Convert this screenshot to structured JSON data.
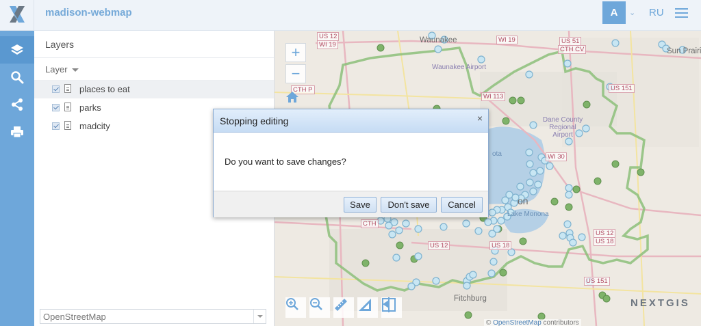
{
  "app": {
    "title": "madison-webmap",
    "logo": "nextgis-x-logo"
  },
  "header": {
    "avatar_letter": "A",
    "language": "RU",
    "menu_icon": "hamburger-menu-icon"
  },
  "sidebar": {
    "items": [
      {
        "icon": "layers-icon",
        "active": true
      },
      {
        "icon": "search-icon",
        "active": false
      },
      {
        "icon": "share-icon",
        "active": false
      },
      {
        "icon": "print-icon",
        "active": false
      }
    ]
  },
  "layers_panel": {
    "title": "Layers",
    "column_header": "Layer",
    "layers": [
      {
        "label": "places to eat",
        "checked": true,
        "selected": true
      },
      {
        "label": "parks",
        "checked": true,
        "selected": false
      },
      {
        "label": "madcity",
        "checked": true,
        "selected": false
      }
    ],
    "basemap": {
      "selected": "OpenStreetMap"
    }
  },
  "map": {
    "zoom_in": "+",
    "zoom_out": "−",
    "brand": "NEXTGIS",
    "attribution_prefix": "©",
    "attribution_link": "OpenStreetMap",
    "attribution_suffix": "contributors",
    "labels": {
      "waunakee": "Waunakee",
      "waunakee_airport": "Waunakee Airport",
      "sun_prairie": "Sun Prairie",
      "dane_county_airport": "Dane County Regional Airport",
      "lake_monona": "Lake Monona",
      "fitchburg": "Fitchburg",
      "madison_fragment": "on",
      "lake_mendota_fragment": "ota"
    },
    "shields": [
      "US 12",
      "WI 19",
      "WI 19",
      "US 51",
      "CTH CV",
      "CTH P",
      "WI 113",
      "WI 30",
      "US 151",
      "US 12",
      "US 18",
      "US 12",
      "US 18",
      "US 151",
      "CTH"
    ],
    "accent_color": "#6ea7da",
    "park_color": "#8cc07a",
    "point_color": "#a8d8ef"
  },
  "dialog": {
    "title": "Stopping editing",
    "message": "Do you want to save changes?",
    "close_symbol": "×",
    "buttons": {
      "save": "Save",
      "dont_save": "Don't save",
      "cancel": "Cancel"
    }
  }
}
